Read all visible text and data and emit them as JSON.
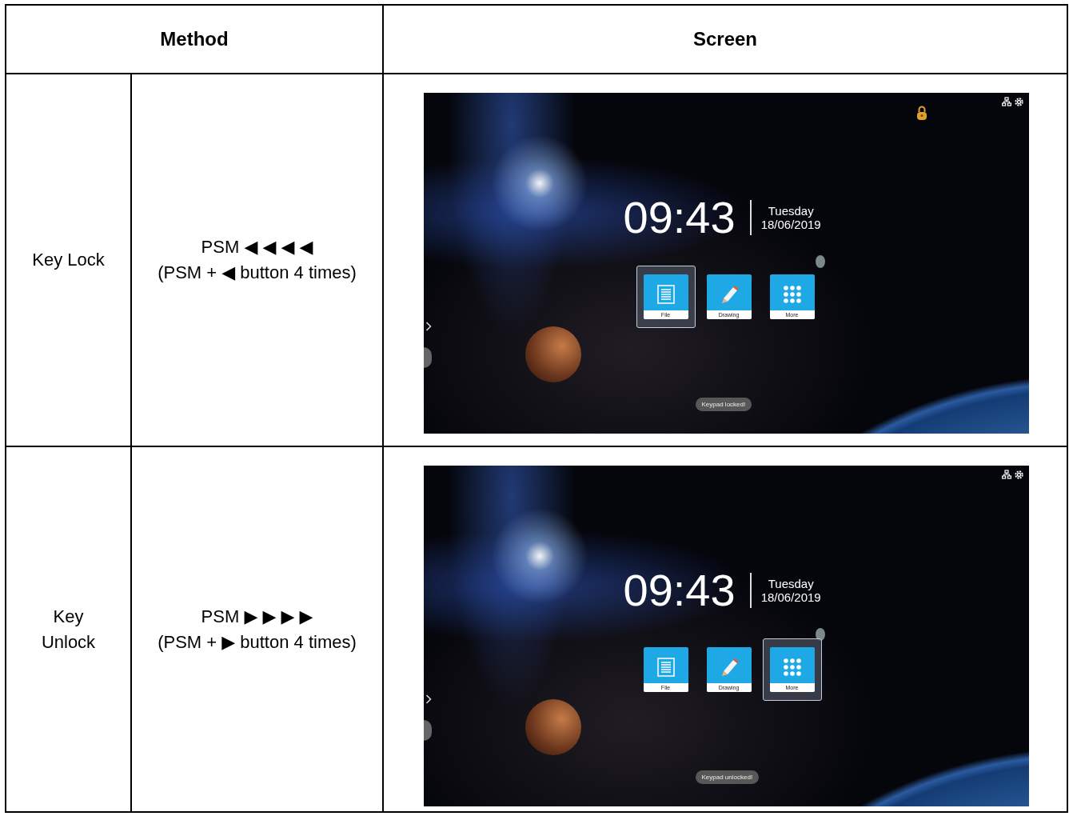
{
  "table": {
    "columns": [
      {
        "label": "Method"
      },
      {
        "label": "Screen"
      }
    ],
    "rows": [
      {
        "method_name": "Key Lock",
        "keys": "PSM ◀ ◀ ◀ ◀",
        "explanation": "(PSM + ◀ button 4 times)",
        "screen": {
          "lock_indicator": true,
          "time": "09:43",
          "day": "Tuesday",
          "date": "18/06/2019",
          "tiles": [
            {
              "label": "File",
              "kind": "file",
              "selected": true
            },
            {
              "label": "Drawing",
              "kind": "drawing",
              "selected": false
            },
            {
              "label": "More",
              "kind": "more",
              "selected": false
            }
          ],
          "toast": "Keypad locked!"
        }
      },
      {
        "method_name": "Key Unlock",
        "keys": "PSM ▶ ▶ ▶ ▶",
        "explanation": "(PSM + ▶ button 4 times)",
        "screen": {
          "lock_indicator": false,
          "time": "09:43",
          "day": "Tuesday",
          "date": "18/06/2019",
          "tiles": [
            {
              "label": "File",
              "kind": "file",
              "selected": false
            },
            {
              "label": "Drawing",
              "kind": "drawing",
              "selected": false
            },
            {
              "label": "More",
              "kind": "more",
              "selected": true
            }
          ],
          "toast": "Keypad unlocked!"
        }
      }
    ]
  }
}
